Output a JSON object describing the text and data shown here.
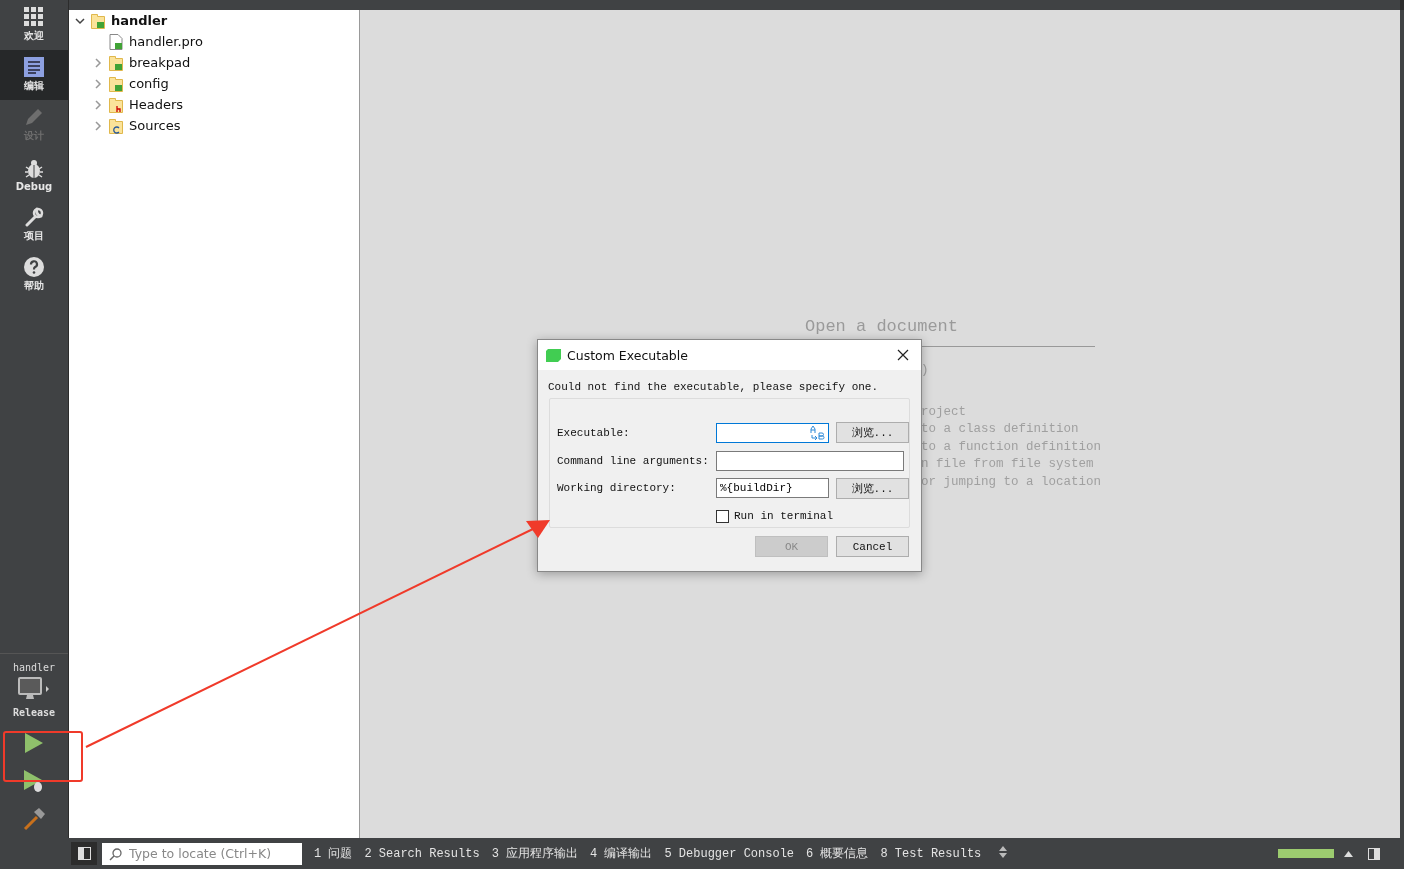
{
  "modes": [
    {
      "label": "欢迎",
      "selected": false,
      "disabled": false
    },
    {
      "label": "编辑",
      "selected": true,
      "disabled": false
    },
    {
      "label": "设计",
      "selected": false,
      "disabled": true
    },
    {
      "label": "Debug",
      "selected": false,
      "disabled": false
    },
    {
      "label": "项目",
      "selected": false,
      "disabled": false
    },
    {
      "label": "帮助",
      "selected": false,
      "disabled": false
    }
  ],
  "kit": {
    "project": "handler",
    "build": "Release"
  },
  "project_tree": {
    "label": "handler",
    "expanded": true,
    "children": [
      {
        "label": "handler.pro",
        "kind": "file"
      },
      {
        "label": "breakpad",
        "kind": "qtfolder",
        "expanded": false
      },
      {
        "label": "config",
        "kind": "qtfolder",
        "expanded": false
      },
      {
        "label": "Headers",
        "kind": "headers",
        "expanded": false
      },
      {
        "label": "Sources",
        "kind": "sources",
        "expanded": false
      }
    ]
  },
  "editor": {
    "title": "Open a document",
    "hints": [
      ")",
      "roject",
      "to a class definition",
      "to a function definition",
      "n file from file system",
      "or jumping to a location"
    ]
  },
  "dialog": {
    "title": "Custom Executable",
    "message": "Could not find the executable, please specify one.",
    "fields": [
      {
        "label": "Executable:",
        "browse": "浏览...",
        "focused": true
      },
      {
        "label": "Command line arguments:",
        "focused": false
      },
      {
        "label": "Working directory:",
        "value": "%{buildDir}",
        "browse": "浏览...",
        "focused": false
      }
    ],
    "run_in_terminal": {
      "label": "Run in terminal",
      "checked": false
    },
    "buttons": [
      {
        "label": "OK",
        "disabled": true
      },
      {
        "label": "Cancel",
        "disabled": false
      }
    ]
  },
  "status_bar": {
    "locator_placeholder": "Type to locate (Ctrl+K)",
    "panes": [
      {
        "number": "1",
        "label": "问题"
      },
      {
        "number": "2",
        "label": "Search Results"
      },
      {
        "number": "3",
        "label": "应用程序输出"
      },
      {
        "number": "4",
        "label": "编译输出"
      },
      {
        "number": "5",
        "label": "Debugger Console"
      },
      {
        "number": "6",
        "label": "概要信息"
      },
      {
        "number": "8",
        "label": "Test Results"
      }
    ],
    "progress": {
      "level": 1
    }
  }
}
